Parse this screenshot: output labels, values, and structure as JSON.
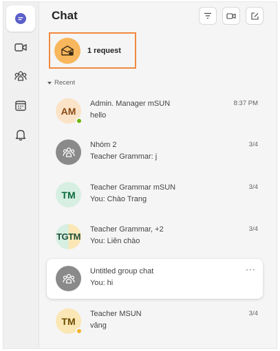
{
  "header": {
    "title": "Chat"
  },
  "request": {
    "label": "1 request"
  },
  "section": {
    "label": "Recent"
  },
  "chats": [
    {
      "name": "Admin. Manager mSUN",
      "preview": "hello",
      "time": "8:37 PM",
      "initials": "AM"
    },
    {
      "name": "Nhóm 2",
      "preview": "Teacher Grammar: j",
      "time": "3/4"
    },
    {
      "name": "Teacher Grammar mSUN",
      "preview": "You: Chào Trang",
      "time": "3/4",
      "initials": "TM"
    },
    {
      "name": "Teacher Grammar, +2",
      "preview": "You: Liên chào",
      "time": "3/4",
      "initials": "TGTM"
    },
    {
      "name": "Untitled group chat",
      "preview": "You: hi",
      "more": "···"
    },
    {
      "name": "Teacher MSUN",
      "preview": "vâng",
      "time": "3/4",
      "initials": "TM"
    }
  ],
  "colors": {
    "accent": "#5b5fc7",
    "request_border": "#f0883e",
    "request_avatar": "#f8b75c",
    "presence_available": "#6bb700",
    "presence_away": "#f2b32c"
  }
}
